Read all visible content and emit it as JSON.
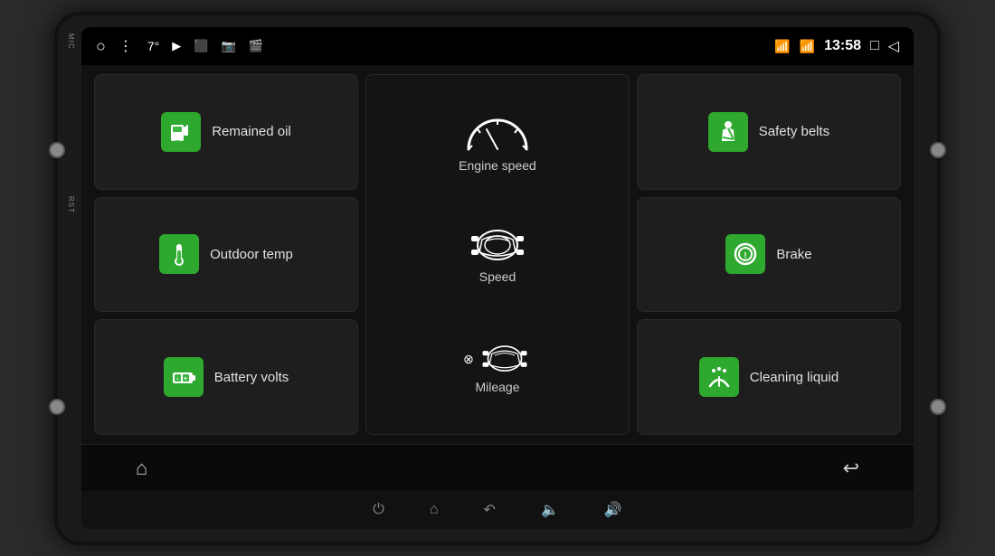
{
  "device": {
    "mic_label": "MIC",
    "rst_label": "RST"
  },
  "status_bar": {
    "circle_icon": "○",
    "menu_icon": "⋮",
    "temperature": "7°",
    "media_icon": "▶",
    "camera1_icon": "⬜",
    "camera2_icon": "📷",
    "camera3_icon": "🎬",
    "bluetooth_icon": "⚡",
    "wifi_icon": "▲",
    "time": "13:58",
    "window_icon": "□",
    "back_icon": "◁"
  },
  "cards": {
    "remained_oil": {
      "label": "Remained oil",
      "icon": "fuel"
    },
    "engine_speed": {
      "label": "Engine speed",
      "icon": "gauge"
    },
    "safety_belts": {
      "label": "Safety belts",
      "icon": "seatbelt"
    },
    "outdoor_temp": {
      "label": "Outdoor temp",
      "icon": "thermometer"
    },
    "speed": {
      "label": "Speed",
      "icon": "car-speed"
    },
    "brake": {
      "label": "Brake",
      "icon": "brake"
    },
    "battery_volts": {
      "label": "Battery volts",
      "icon": "battery"
    },
    "mileage": {
      "label": "Mileage",
      "icon": "car-mileage"
    },
    "cleaning_liquid": {
      "label": "Cleaning liquid",
      "icon": "wiper"
    }
  },
  "nav_bar": {
    "home_icon": "⌂",
    "back_icon": "↩"
  },
  "bottom_buttons": {
    "power_icon": "⏻",
    "home_icon": "⌂",
    "back_icon": "↶",
    "vol_down_icon": "🔈",
    "vol_up_icon": "🔊"
  },
  "colors": {
    "green": "#3cb843",
    "dark_bg": "#111111",
    "card_bg": "#1e1e1e",
    "text_primary": "#e0e0e0",
    "status_bar_bg": "#000000"
  }
}
